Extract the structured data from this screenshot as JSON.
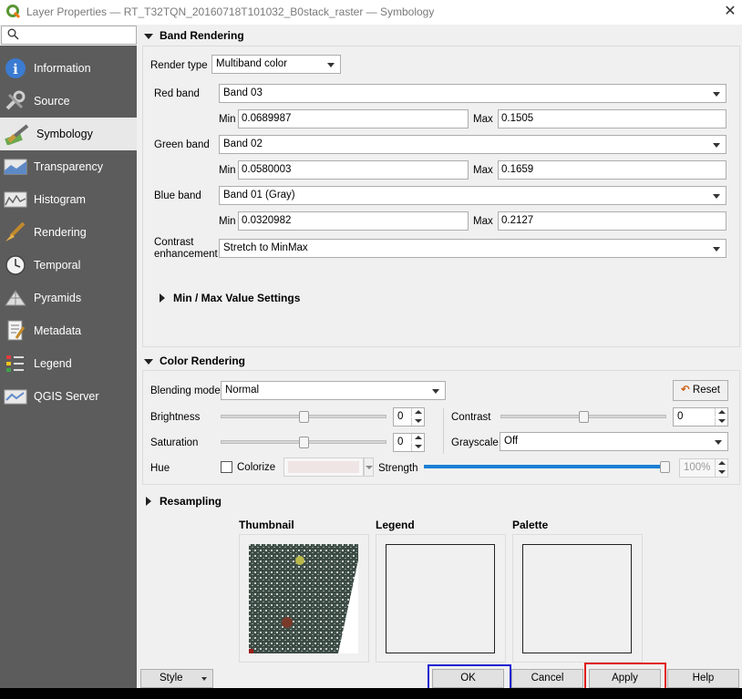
{
  "window": {
    "title": "Layer Properties — RT_T32TQN_20160718T101032_B0stack_raster — Symbology"
  },
  "search": {
    "placeholder": ""
  },
  "sidebar": {
    "items": [
      {
        "label": "Information",
        "icon": "info-icon"
      },
      {
        "label": "Source",
        "icon": "source-tools-icon"
      },
      {
        "label": "Symbology",
        "icon": "symbology-brush-icon"
      },
      {
        "label": "Transparency",
        "icon": "transparency-icon"
      },
      {
        "label": "Histogram",
        "icon": "histogram-icon"
      },
      {
        "label": "Rendering",
        "icon": "rendering-brush-icon"
      },
      {
        "label": "Temporal",
        "icon": "clock-icon"
      },
      {
        "label": "Pyramids",
        "icon": "pyramid-icon"
      },
      {
        "label": "Metadata",
        "icon": "metadata-icon"
      },
      {
        "label": "Legend",
        "icon": "legend-icon"
      },
      {
        "label": "QGIS Server",
        "icon": "qgis-server-icon"
      }
    ],
    "active_index": 2
  },
  "band_rendering": {
    "heading": "Band Rendering",
    "render_type_label": "Render type",
    "render_type_value": "Multiband color",
    "red_label": "Red band",
    "red_value": "Band 03",
    "red_min": "0.0689987",
    "red_max": "0.1505",
    "green_label": "Green band",
    "green_value": "Band 02",
    "green_min": "0.0580003",
    "green_max": "0.1659",
    "blue_label": "Blue band",
    "blue_value": "Band 01 (Gray)",
    "blue_min": "0.0320982",
    "blue_max": "0.2127",
    "min_label": "Min",
    "max_label": "Max",
    "contrast_label_1": "Contrast",
    "contrast_label_2": "enhancement",
    "contrast_value": "Stretch to MinMax",
    "minmax_settings": "Min / Max Value Settings"
  },
  "color_rendering": {
    "heading": "Color Rendering",
    "blending_label": "Blending mode",
    "blending_value": "Normal",
    "reset_label": "Reset",
    "brightness_label": "Brightness",
    "brightness_value": "0",
    "brightness_level": 0.5,
    "contrast_label": "Contrast",
    "contrast_value": "0",
    "contrast_level": 0.5,
    "saturation_label": "Saturation",
    "saturation_value": "0",
    "saturation_level": 0.5,
    "grayscale_label": "Grayscale",
    "grayscale_value": "Off",
    "hue_label": "Hue",
    "colorize_label": "Colorize",
    "strength_label": "Strength",
    "strength_value": "100%",
    "strength_level": 1.0
  },
  "resampling": {
    "heading": "Resampling",
    "thumbnail_label": "Thumbnail",
    "legend_label": "Legend",
    "palette_label": "Palette"
  },
  "buttons": {
    "style": "Style",
    "ok": "OK",
    "cancel": "Cancel",
    "apply": "Apply",
    "help": "Help"
  },
  "colors": {
    "sidebar_bg": "#5c5c5c",
    "strength_fill": "#1a7fd6",
    "ok_highlight": "#1f1fd0",
    "apply_highlight": "#e01818"
  }
}
